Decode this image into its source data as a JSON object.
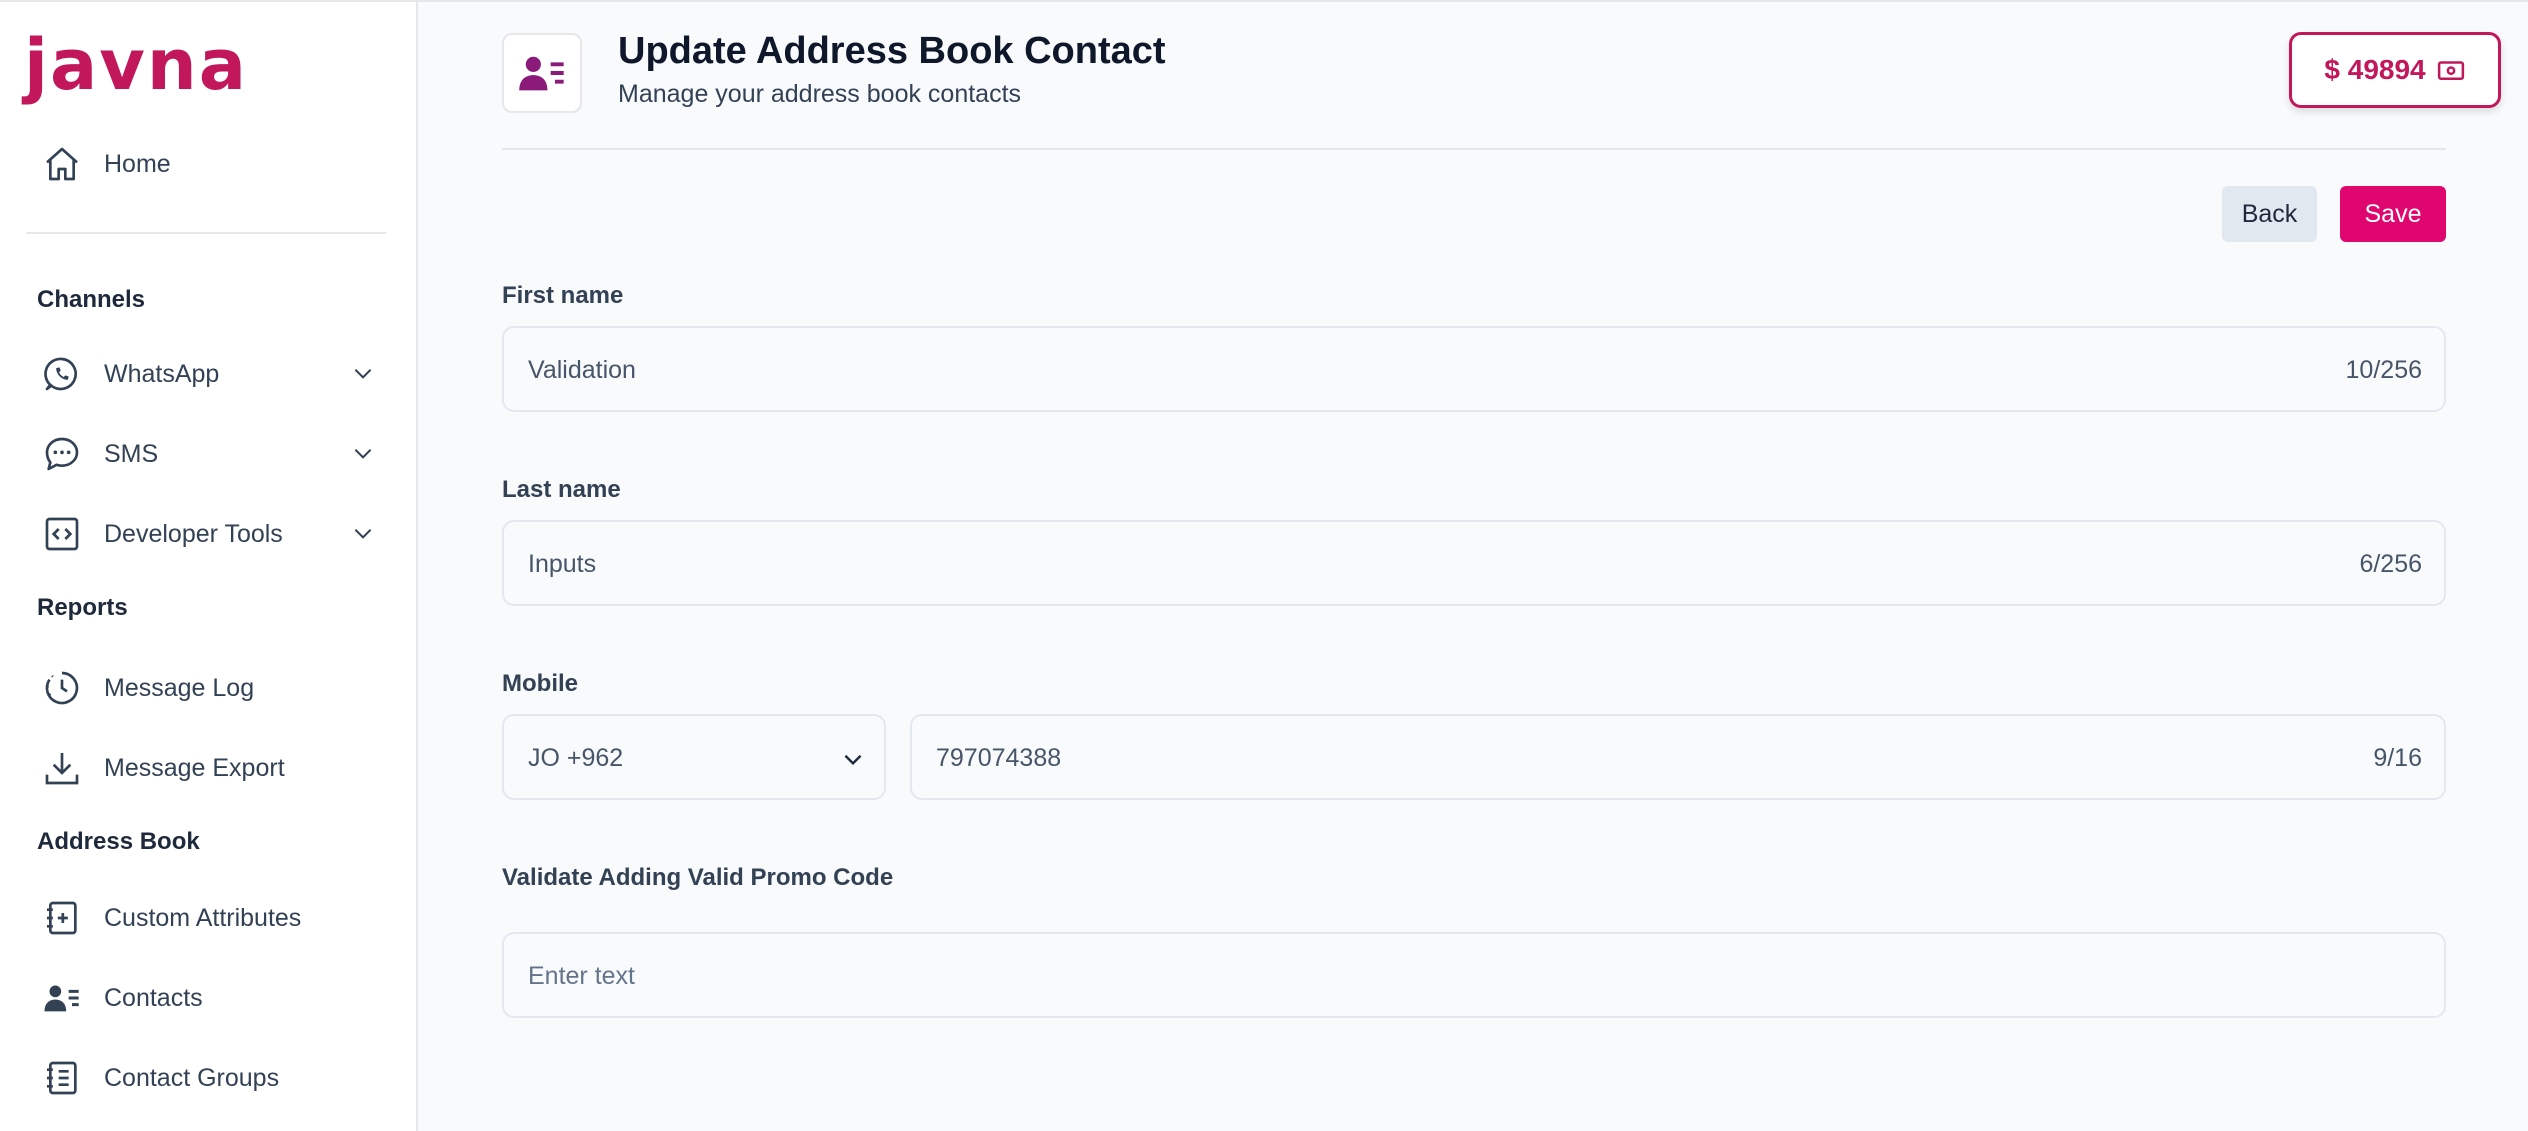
{
  "brand": {
    "logo_text": "javna",
    "accent_color": "#c2185b"
  },
  "sidebar": {
    "home_label": "Home",
    "sections": {
      "channels": "Channels",
      "reports": "Reports",
      "address_book": "Address Book"
    },
    "items": [
      {
        "label": "WhatsApp",
        "icon": "whatsapp-icon",
        "expandable": true
      },
      {
        "label": "SMS",
        "icon": "chat-bubble-icon",
        "expandable": true
      },
      {
        "label": "Developer Tools",
        "icon": "code-icon",
        "expandable": true
      },
      {
        "label": "Message Log",
        "icon": "clock-icon",
        "expandable": false
      },
      {
        "label": "Message Export",
        "icon": "download-icon",
        "expandable": false
      },
      {
        "label": "Custom Attributes",
        "icon": "notebook-plus-icon",
        "expandable": false
      },
      {
        "label": "Contacts",
        "icon": "contact-card-icon",
        "expandable": false
      },
      {
        "label": "Contact Groups",
        "icon": "notebook-list-icon",
        "expandable": false
      }
    ]
  },
  "header": {
    "title": "Update Address Book Contact",
    "subtitle": "Manage your address book contacts",
    "balance": "$ 49894"
  },
  "actions": {
    "back_label": "Back",
    "save_label": "Save",
    "save_color": "#e0066f"
  },
  "form": {
    "first_name": {
      "label": "First name",
      "value": "Validation",
      "counter": "10/256"
    },
    "last_name": {
      "label": "Last name",
      "value": "Inputs",
      "counter": "6/256"
    },
    "mobile": {
      "label": "Mobile",
      "country_code": "JO +962",
      "value": "797074388",
      "counter": "9/16"
    },
    "promo": {
      "label": "Validate Adding Valid Promo Code",
      "placeholder": "Enter text"
    }
  }
}
